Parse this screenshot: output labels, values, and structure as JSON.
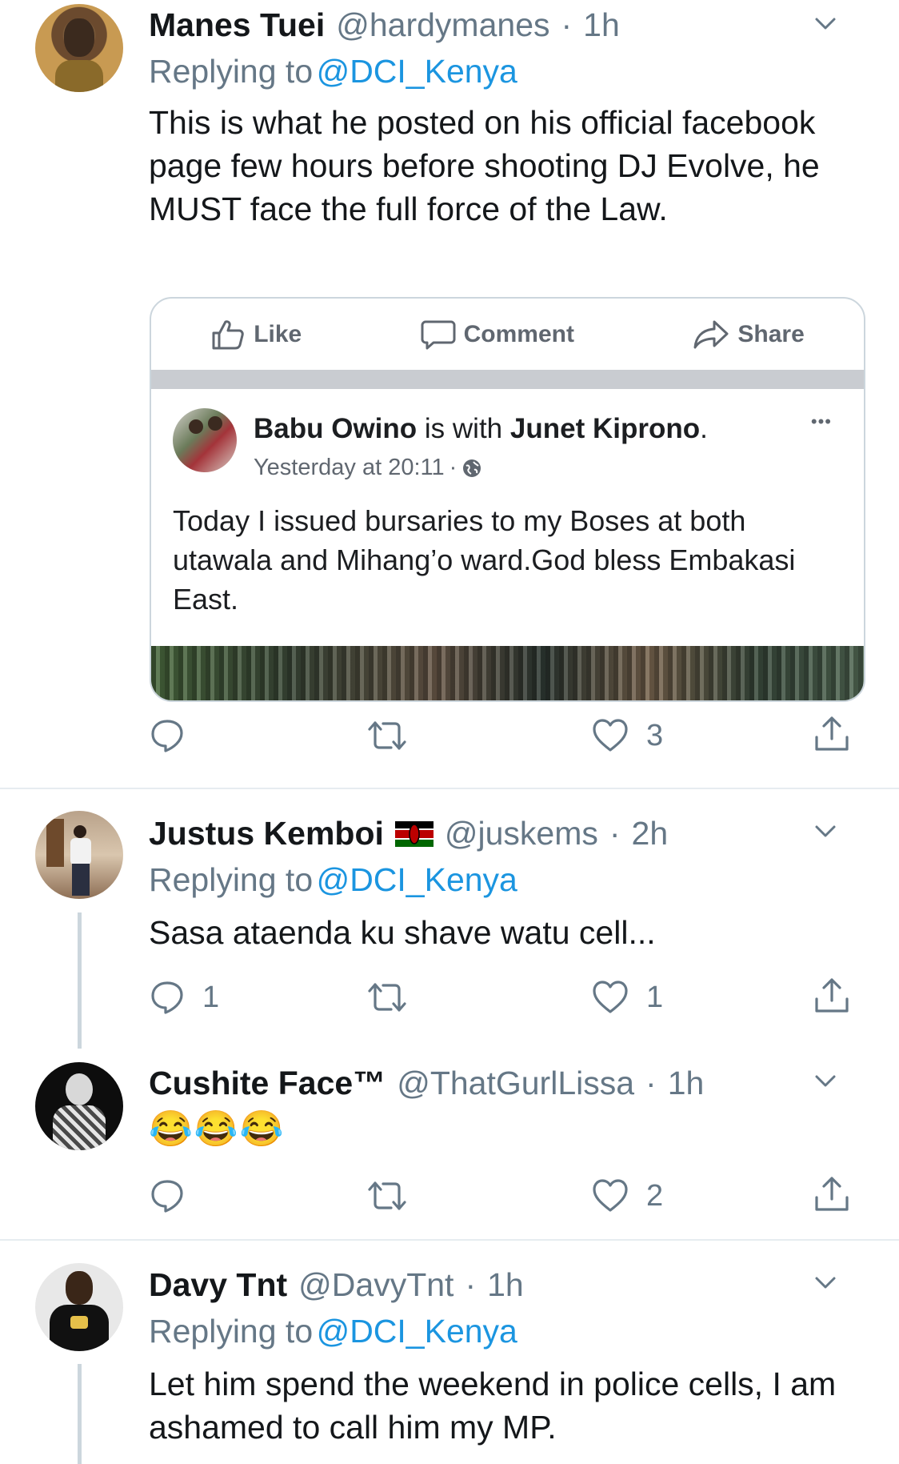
{
  "tweets": [
    {
      "name": "Manes Tuei",
      "handle": "@hardymanes",
      "dot": "·",
      "time": "1h",
      "replying_prefix": "Replying to",
      "replying_to": "@DCI_Kenya",
      "text": "This is what he posted on his official facebook page few hours before shooting DJ Evolve, he MUST face the full force of the Law.",
      "replies": "",
      "likes": "3"
    },
    {
      "name": "Justus Kemboi",
      "handle": "@juskems",
      "dot": "·",
      "time": "2h",
      "replying_prefix": "Replying to",
      "replying_to": "@DCI_Kenya",
      "text": "Sasa ataenda ku shave watu cell...",
      "replies": "1",
      "likes": "1"
    },
    {
      "name": "Cushite Face™",
      "handle": "@ThatGurlLissa",
      "dot": "·",
      "time": "1h",
      "text": "😂😂😂",
      "replies": "",
      "likes": "2"
    },
    {
      "name": "Davy Tnt",
      "handle": "@DavyTnt",
      "dot": "·",
      "time": "1h",
      "replying_prefix": "Replying to",
      "replying_to": "@DCI_Kenya",
      "text": "Let him spend the weekend in police cells, I am ashamed to call him my MP."
    }
  ],
  "facebook_card": {
    "like": "Like",
    "comment": "Comment",
    "share": "Share",
    "author": "Babu Owino",
    "with_text": "is with",
    "with_name": "Junet Kiprono",
    "period": ".",
    "time": "Yesterday at 20:11",
    "time_sep": "·",
    "more": "•••",
    "text": "Today I issued bursaries to my Boses at both utawala and Mihang’o ward.God bless Embakasi East."
  },
  "colors": {
    "link": "#1b95e0",
    "gray": "#657786",
    "text": "#14171a",
    "divider": "#e6ecf0"
  },
  "icons": [
    "reply-icon",
    "retweet-icon",
    "like-icon",
    "share-icon",
    "chevron-down-icon",
    "kenya-flag-icon",
    "globe-icon"
  ]
}
